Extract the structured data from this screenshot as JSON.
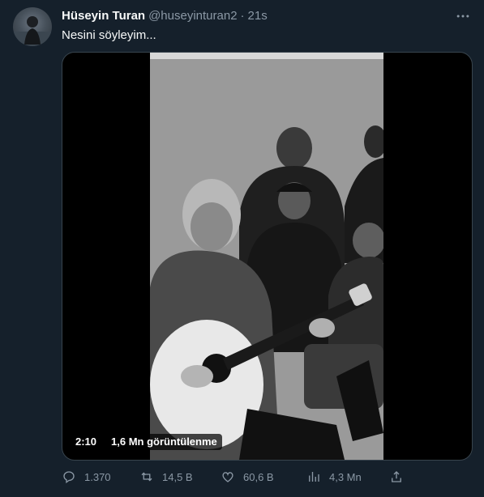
{
  "tweet": {
    "author_name": "Hüseyin Turan",
    "author_handle": "@huseyinturan2",
    "separator": "·",
    "time": "21s",
    "text": "Nesini söyleyim..."
  },
  "video": {
    "duration": "2:10",
    "views": "1,6 Mn görüntülenme"
  },
  "actions": {
    "replies": "1.370",
    "retweets": "14,5 B",
    "likes": "60,6 B",
    "views": "4,3 Mn"
  },
  "icons": [
    "more-icon",
    "reply-icon",
    "retweet-icon",
    "like-icon",
    "analytics-icon",
    "share-icon"
  ],
  "colors": {
    "background": "#15202b",
    "text": "#f7f9f9",
    "secondary": "#8b98a5",
    "border": "#38444d"
  }
}
